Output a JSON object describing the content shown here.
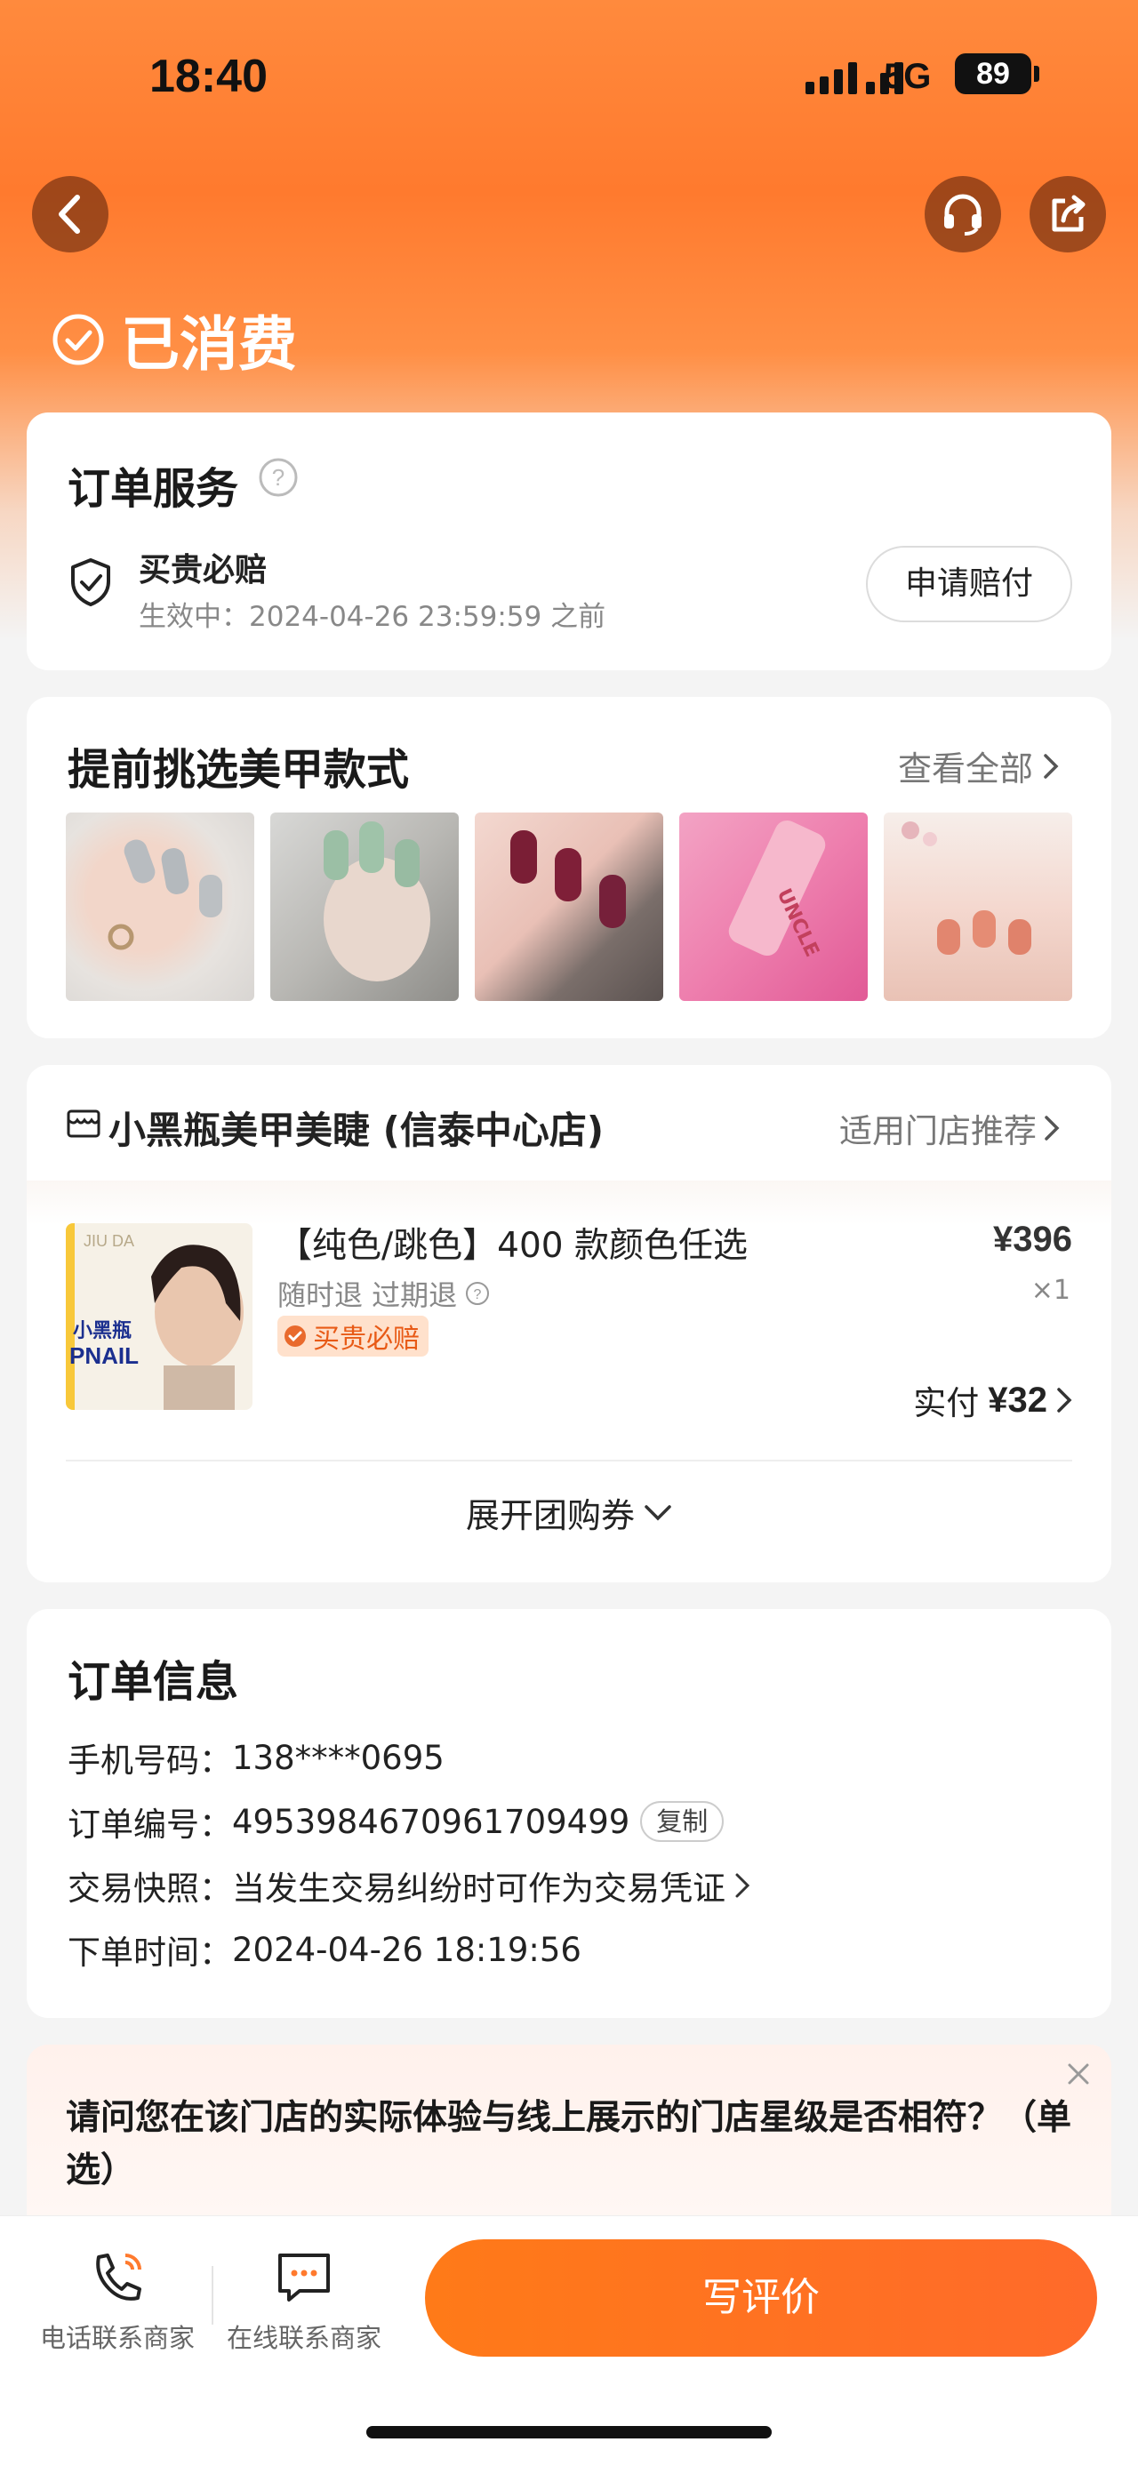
{
  "status_bar": {
    "time": "18:40",
    "network": "5G",
    "battery": "89"
  },
  "header": {
    "state_label": "已消费"
  },
  "order_service": {
    "title": "订单服务",
    "service_name": "买贵必赔",
    "valid_text": "生效中：2024-04-26 23:59:59 之前",
    "claim_button": "申请赔付"
  },
  "nail_styles": {
    "title": "提前挑选美甲款式",
    "see_all": "查看全部"
  },
  "shop": {
    "name": "小黑瓶美甲美睫 (信泰中心店)",
    "store_recommend": "适用门店推荐",
    "product": {
      "title": "【纯色/跳色】400 款颜色任选",
      "refund_terms": "随时退 过期退",
      "guarantee_tag": "买贵必赔",
      "price": "¥396",
      "quantity": "×1",
      "paid_label": "实付",
      "paid_amount": "¥32",
      "image_text_top": "JIU DA",
      "image_text_brand": "小黑瓶",
      "image_text_brand2": "PNAIL"
    },
    "expand_label": "展开团购券"
  },
  "order_info": {
    "title": "订单信息",
    "phone_label": "手机号码：",
    "phone_value": "138****0695",
    "order_no_label": "订单编号：",
    "order_no_value": "4953984670961709499",
    "copy_label": "复制",
    "snapshot_label": "交易快照：",
    "snapshot_value": "当发生交易纠纷时可作为交易凭证",
    "time_label": "下单时间：",
    "time_value": "2024-04-26 18:19:56"
  },
  "survey": {
    "question": "请问您在该门店的实际体验与线上展示的门店星级是否相符？（单选）"
  },
  "bottom_bar": {
    "call_label": "电话联系商家",
    "chat_label": "在线联系商家",
    "review_label": "写评价"
  },
  "colors": {
    "accent": "#ff7a18",
    "header_top": "#ff8a3d",
    "guarantee_bg": "#ffe1cc"
  }
}
